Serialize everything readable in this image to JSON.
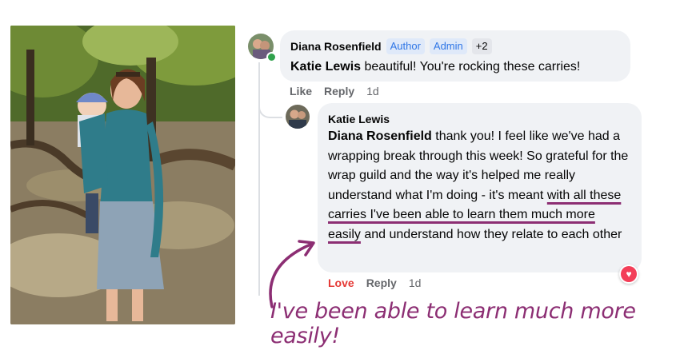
{
  "comment_1": {
    "author": "Diana Rosenfield",
    "badges": [
      "Author",
      "Admin",
      "+2"
    ],
    "mention": "Katie Lewis",
    "text": " beautiful! You're rocking these carries!",
    "actions": {
      "like": "Like",
      "reply": "Reply",
      "time": "1d"
    }
  },
  "comment_2": {
    "author": "Katie Lewis",
    "mention": "Diana Rosenfield",
    "text_part1": " thank you! I feel like we've had a wrapping break through this week! So grateful for the wrap guild and the way it's helped me really understand what I'm doing - it's meant ",
    "text_highlight": "with all these carries I've been able to learn them much more easily",
    "text_part2": " and understand how they relate to each other",
    "actions": {
      "love": "Love",
      "reply": "Reply",
      "time": "1d"
    },
    "reaction_icon": "heart-icon"
  },
  "caption": "I've been able to learn much more easily!",
  "colors": {
    "accent": "#8c2e73",
    "badge_text": "#2f76e6",
    "bubble": "#f0f2f5",
    "love": "#e53935"
  }
}
